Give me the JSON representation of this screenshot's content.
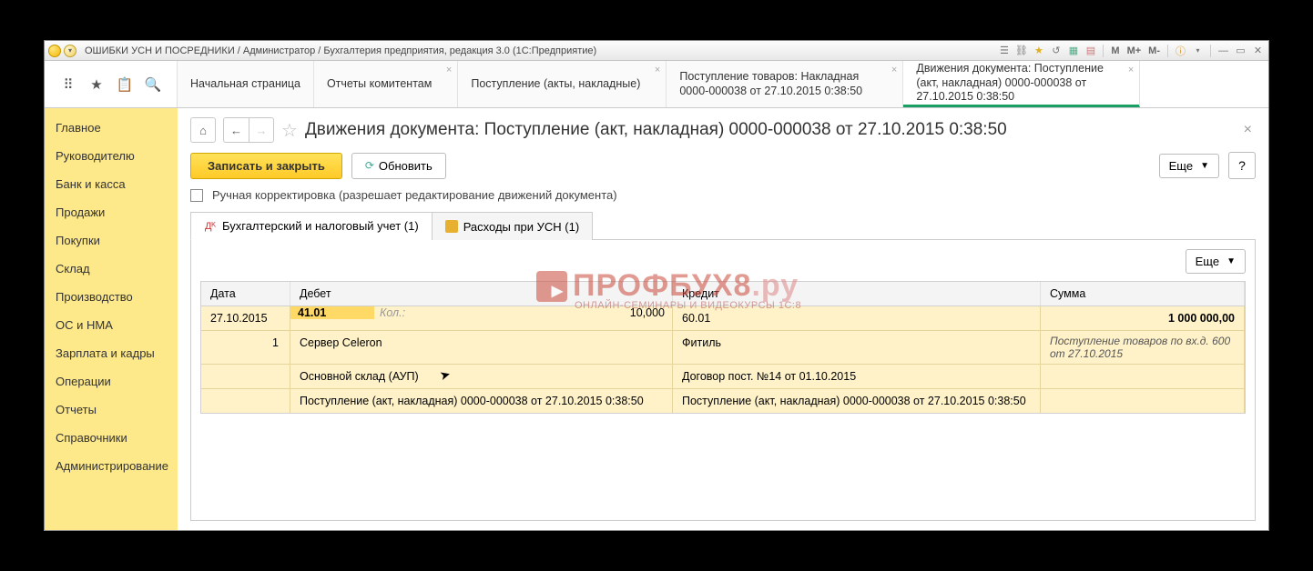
{
  "titlebar": {
    "text": "ОШИБКИ УСН И ПОСРЕДНИКИ / Администратор / Бухгалтерия предприятия, редакция 3.0  (1С:Предприятие)",
    "m": "М",
    "mplus": "М+",
    "mminus": "М-"
  },
  "tabs": [
    {
      "label": "Начальная страница",
      "close": false
    },
    {
      "label": "Отчеты комитентам",
      "close": true
    },
    {
      "label": "Поступление (акты, накладные)",
      "close": true
    },
    {
      "label": "Поступление товаров: Накладная 0000-000038 от 27.10.2015 0:38:50",
      "close": true
    },
    {
      "label": "Движения документа: Поступление (акт, накладная) 0000-000038 от 27.10.2015 0:38:50",
      "close": true
    }
  ],
  "sidebar": [
    "Главное",
    "Руководителю",
    "Банк и касса",
    "Продажи",
    "Покупки",
    "Склад",
    "Производство",
    "ОС и НМА",
    "Зарплата и кадры",
    "Операции",
    "Отчеты",
    "Справочники",
    "Администрирование"
  ],
  "doc": {
    "title": "Движения документа: Поступление (акт, накладная) 0000-000038 от 27.10.2015 0:38:50",
    "save_close": "Записать и закрыть",
    "refresh": "Обновить",
    "more": "Еще",
    "manual_label": "Ручная корректировка (разрешает редактирование движений документа)"
  },
  "subtabs": [
    "Бухгалтерский и налоговый учет (1)",
    "Расходы при УСН (1)"
  ],
  "grid": {
    "headers": {
      "date": "Дата",
      "debit": "Дебет",
      "credit": "Кредит",
      "sum": "Сумма"
    },
    "more": "Еще",
    "rows": {
      "date": "27.10.2015",
      "num": "1",
      "deb_acct": "41.01",
      "kol_label": "Кол.:",
      "qty": "10,000",
      "cred_acct": "60.01",
      "sum": "1 000 000,00",
      "deb_item": "Сервер Celeron",
      "cred_party": "Фитиль",
      "sum_note": "Поступление товаров по вх.д. 600 от 27.10.2015",
      "deb_store": "Основной склад (АУП)",
      "cred_contract": "Договор пост. №14 от 01.10.2015",
      "deb_doc": "Поступление (акт, накладная) 0000-000038 от 27.10.2015 0:38:50",
      "cred_doc": "Поступление (акт, накладная) 0000-000038 от 27.10.2015 0:38:50"
    }
  },
  "watermark": {
    "main": "ПРОФБУХ8",
    "suffix": ".ру",
    "sub": "ОНЛАЙН-СЕМИНАРЫ И ВИДЕОКУРСЫ 1С:8"
  }
}
